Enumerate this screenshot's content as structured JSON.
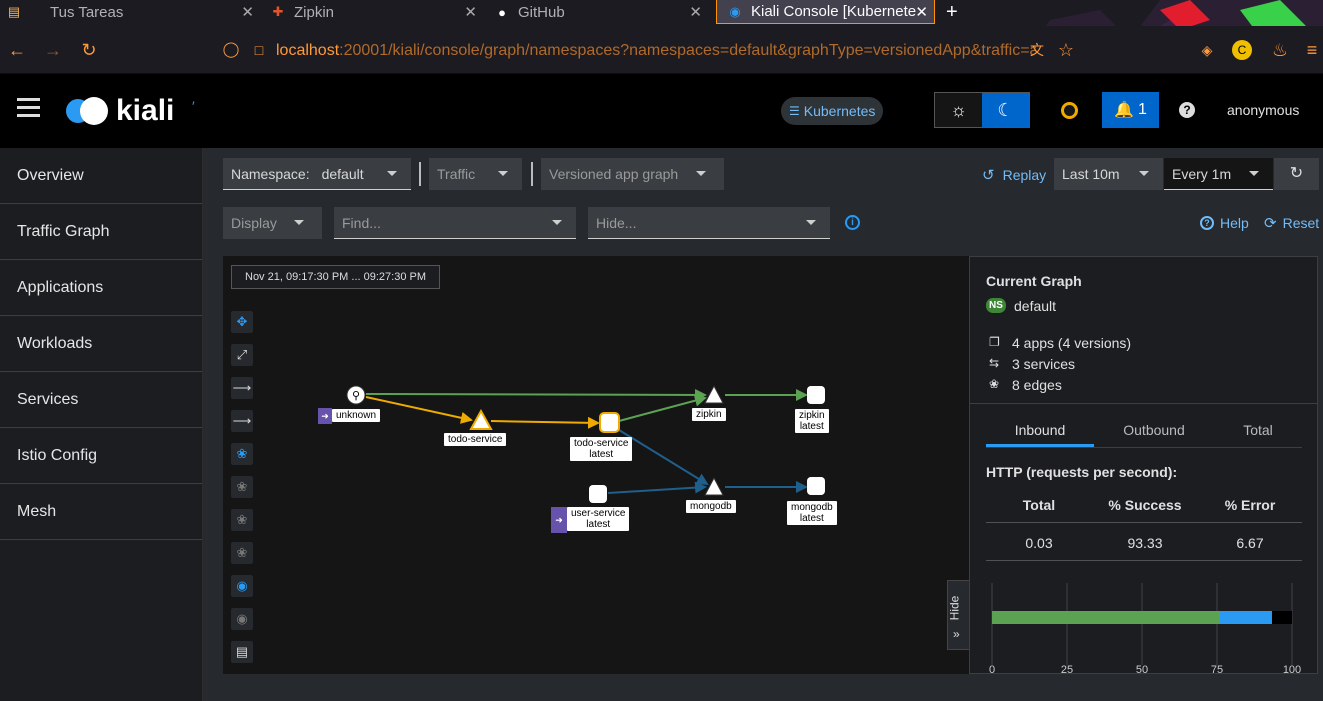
{
  "browser": {
    "tabs": [
      {
        "title": "Tus Tareas",
        "icon": "folder-icon"
      },
      {
        "title": "Zipkin",
        "icon": "zipkin-icon"
      },
      {
        "title": "GitHub",
        "icon": "github-icon"
      },
      {
        "title": "Kiali Console [Kubernete",
        "icon": "kiali-icon"
      }
    ],
    "url_host": "localhost",
    "url_rest": ":20001/kiali/console/graph/namespaces?namespaces=default&graphType=versionedApp&traffic=a"
  },
  "header": {
    "brand": "kiali",
    "cluster_badge": "Kubernetes",
    "notifications_count": "1",
    "user": "anonymous"
  },
  "sidebar": {
    "items": [
      {
        "label": "Overview"
      },
      {
        "label": "Traffic Graph"
      },
      {
        "label": "Applications"
      },
      {
        "label": "Workloads"
      },
      {
        "label": "Services"
      },
      {
        "label": "Istio Config"
      },
      {
        "label": "Mesh"
      }
    ]
  },
  "toolbar": {
    "namespace_label": "Namespace:",
    "namespace_value": "default",
    "traffic_label": "Traffic",
    "graph_type": "Versioned app graph",
    "replay_label": "Replay",
    "duration": "Last 10m",
    "refresh": "Every 1m",
    "display_label": "Display",
    "find_placeholder": "Find...",
    "hide_placeholder": "Hide...",
    "help_label": "Help",
    "reset_label": "Reset"
  },
  "graph": {
    "time_range": "Nov 21, 09:17:30 PM ... 09:27:30 PM",
    "nodes": [
      {
        "label": "unknown"
      },
      {
        "label": "todo-service"
      },
      {
        "label_line1": "todo-service",
        "label_line2": "latest"
      },
      {
        "label": "zipkin"
      },
      {
        "label_line1": "zipkin",
        "label_line2": "latest"
      },
      {
        "label_line1": "user-service",
        "label_line2": "latest"
      },
      {
        "label": "mongodb"
      },
      {
        "label_line1": "mongodb",
        "label_line2": "latest"
      }
    ],
    "hide_label": "Hide"
  },
  "panel": {
    "title": "Current Graph",
    "ns_badge": "NS",
    "namespace": "default",
    "apps": "4 apps (4 versions)",
    "services": "3 services",
    "edges": "8 edges",
    "tabs": [
      "Inbound",
      "Outbound",
      "Total"
    ],
    "http_title": "HTTP (requests per second):",
    "table_headers": [
      "Total",
      "% Success",
      "% Error"
    ],
    "table_values": [
      "0.03",
      "93.33",
      "6.67"
    ],
    "bar": {
      "success_pct": 93.33,
      "error_pct": 6.67,
      "colors": {
        "ok": "#5ba352",
        "info": "#2b9af3",
        "error": "#000000"
      }
    },
    "axis_ticks": [
      "0",
      "25",
      "50",
      "75",
      "100"
    ]
  },
  "colors": {
    "accent": "#2b9af3",
    "brand_blue": "#0066cc",
    "edge_orange": "#f0ab00",
    "edge_green": "#5ba352",
    "edge_blue": "#1f5f8b",
    "app_purple": "#6753ac"
  }
}
